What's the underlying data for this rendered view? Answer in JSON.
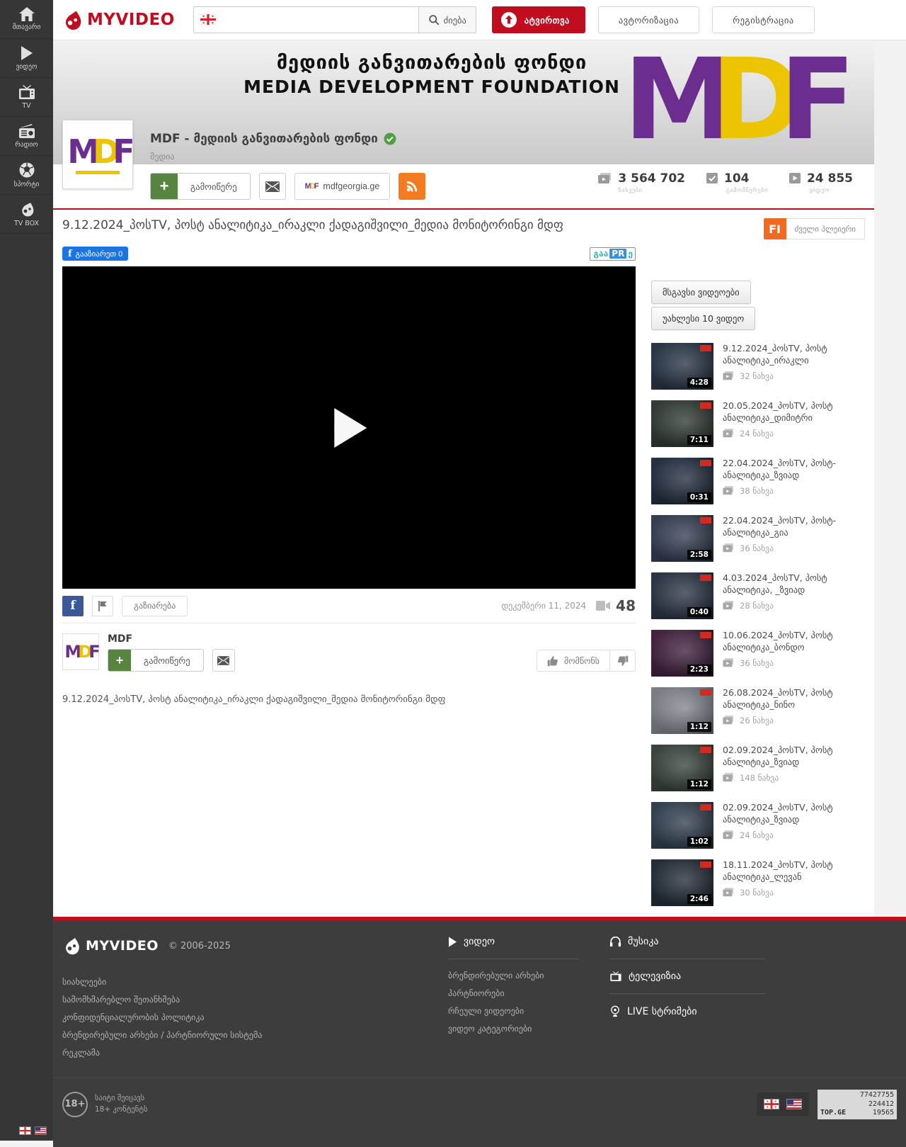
{
  "header": {
    "brand": "MYVIDEO",
    "search_value": "",
    "search_button": "ძიება",
    "upload": "ატვირთვა",
    "authorization": "ავტორიზაცია",
    "registration": "რეგისტრაცია"
  },
  "sidebar": {
    "items": [
      {
        "label": "მთავარი"
      },
      {
        "label": "ვიდეო"
      },
      {
        "label": "TV"
      },
      {
        "label": "რადიო"
      },
      {
        "label": "სპორტი"
      },
      {
        "label": "TV BOX"
      }
    ]
  },
  "channel": {
    "banner_title_ka": "მედიის განვითარების ფონდი",
    "banner_title_en": "MEDIA DEVELOPMENT FOUNDATION",
    "logo_m": "M",
    "logo_d": "D",
    "logo_f": "F",
    "name": "MDF - მედიის განვითარების ფონდი",
    "category": "მედია",
    "subscribe": "გამოიწერე",
    "website": "mdfgeorgia.ge",
    "website_logo": "MDF",
    "stats": [
      {
        "value": "3 564 702",
        "label": "ნახვები"
      },
      {
        "value": "104",
        "label": "გამომწერები"
      },
      {
        "value": "24 855",
        "label": "ვიდეო"
      }
    ]
  },
  "video": {
    "title": "9.12.2024_პოსTV, პოსტ ანალიტიკა_ირაკლი ქადაგიშვილი_მედია მონიტორინგი მდფ",
    "fb_like": "გააზიარეთ 0",
    "pr_part1": "გაა",
    "pr_part2": "PR",
    "pr_part3": "ე",
    "fi": "FI",
    "old_player": "ძველი პლეიერი",
    "fb_f": "f",
    "share": "გაზიარება",
    "date": "დეკემბერი 11, 2024",
    "views": "48",
    "description": "9.12.2024_პოსTV, პოსტ ანალიტიკა_ირაკლი ქადაგიშვილი_მედია მონიტორინგი მდფ"
  },
  "channel_card": {
    "name": "MDF",
    "subscribe": "გამოიწერე",
    "like": "მომწონს"
  },
  "related": {
    "tabs": [
      {
        "label": "მსგავსი ვიდეოები"
      },
      {
        "label": "უახლესი 10 ვიდეო"
      }
    ],
    "items": [
      {
        "title": "9.12.2024_პოსTV, პოსტ ანალიტიკა_ირაკლი",
        "views": "32 ნახვა",
        "duration": "4:28"
      },
      {
        "title": "20.05.2024_პოსTV, პოსტ ანალიტიკა_დიმიტრი",
        "views": "24 ნახვა",
        "duration": "7:11"
      },
      {
        "title": "22.04.2024_პოსTV, პოსტ-ანალიტიკა_ზვიად",
        "views": "38 ნახვა",
        "duration": "0:31"
      },
      {
        "title": "22.04.2024_პოსTV, პოსტ-ანალიტიკა_გია",
        "views": "36 ნახვა",
        "duration": "2:58"
      },
      {
        "title": "4.03.2024_პოსTV, პოსტ ანალიტიკა, _ზვიად",
        "views": "28 ნახვა",
        "duration": "0:40"
      },
      {
        "title": "10.06.2024_პოსTV, პოსტ ანალიტიკა_ბონდო",
        "views": "36 ნახვა",
        "duration": "2:23"
      },
      {
        "title": "26.08.2024_პოსTV, პოსტ ანალიტიკა_ნინო",
        "views": "26 ნახვა",
        "duration": "1:12"
      },
      {
        "title": "02.09.2024_პოსTV, პოსტ ანალიტიკა_ზვიად",
        "views": "148 ნახვა",
        "duration": "1:12"
      },
      {
        "title": "02.09.2024_პოსTV, პოსტ ანალიტიკა_ზვიად",
        "views": "24 ნახვა",
        "duration": "1:02"
      },
      {
        "title": "18.11.2024_პოსTV, პოსტ ანალიტიკა_ლევან",
        "views": "30 ნახვა",
        "duration": "2:46"
      }
    ]
  },
  "footer": {
    "brand": "MYVIDEO",
    "copyright": "© 2006-2025",
    "links": [
      "სიახლეები",
      "სამომხმარებლო შეთანხმება",
      "კონფიდენციალურობის პოლიტიკა",
      "ბრენდირებული არხები / პარტნიორული სისტემა",
      "რეკლამა"
    ],
    "video_header": "ვიდეო",
    "video_links": [
      "ბრენდირებული არხები",
      "პარტნიორები",
      "რჩეული ვიდეოები",
      "ვიდეო კატეგორიები"
    ],
    "music": "მუსიკა",
    "tv": "ტელევიზია",
    "live": "LIVE სტრიმები",
    "age_badge": "18+",
    "age_line1": "საიტი შეიცავს",
    "age_line2": "18+ კონტენტს",
    "topge_label": "TOP.GE",
    "topge_n1": "77427755",
    "topge_n2": "224412",
    "topge_n3": "19565"
  }
}
